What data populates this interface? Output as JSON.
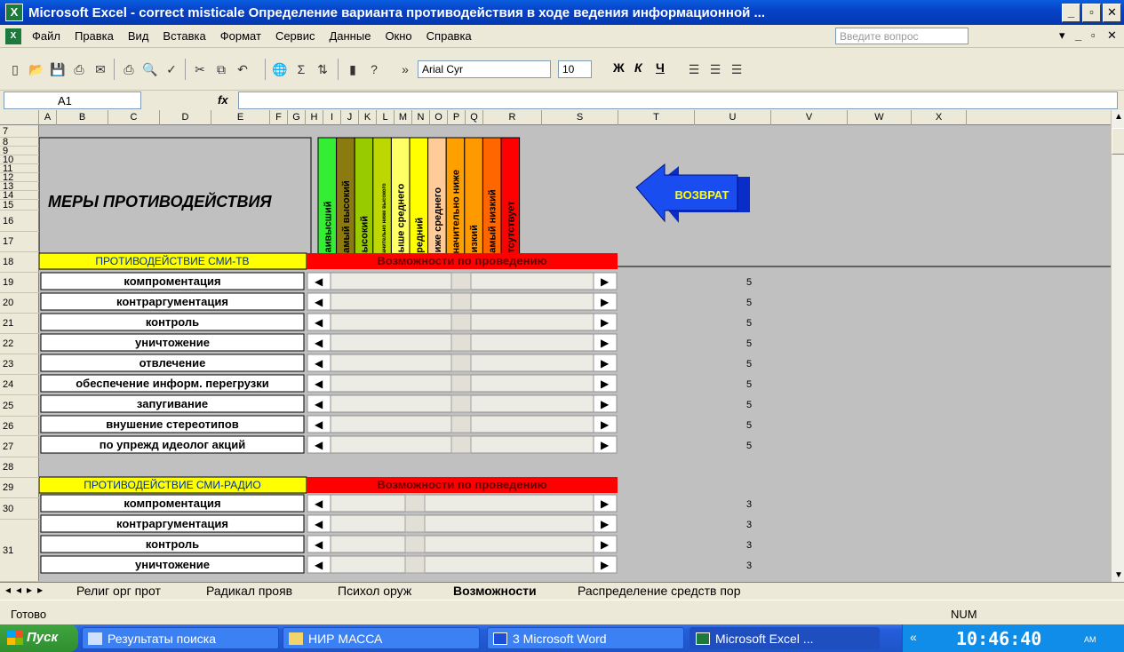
{
  "window": {
    "title": "Microsoft Excel - correct misticale Определение варианта противодействия в ходе ведения информационной ..."
  },
  "menu": {
    "items": [
      "Файл",
      "Правка",
      "Вид",
      "Вставка",
      "Формат",
      "Сервис",
      "Данные",
      "Окно",
      "Справка"
    ],
    "ask_placeholder": "Введите вопрос"
  },
  "toolbar": {
    "font": "Arial Cyr",
    "size": "10"
  },
  "formula": {
    "cell": "A1",
    "fx": "fx"
  },
  "columns": [
    "A",
    "B",
    "C",
    "D",
    "E",
    "F",
    "G",
    "H",
    "I",
    "J",
    "K",
    "L",
    "M",
    "N",
    "O",
    "P",
    "Q",
    "R",
    "S",
    "T",
    "U",
    "V",
    "W",
    "X"
  ],
  "rows": [
    "7",
    "8",
    "9",
    "10",
    "11",
    "12",
    "13",
    "14",
    "15",
    "16",
    "17",
    "18",
    "19",
    "20",
    "21",
    "22",
    "23",
    "24",
    "25",
    "26",
    "27",
    "28",
    "29",
    "30",
    "31"
  ],
  "header": {
    "measures": "МЕРЫ ПРОТИВОДЕЙСТВИЯ",
    "levels": [
      {
        "label": "наивысший",
        "color": "#33ee33"
      },
      {
        "label": "самый высокий",
        "color": "#8b7a10"
      },
      {
        "label": "высокий",
        "color": "#99cc00"
      },
      {
        "label": "значительно ниже высокого",
        "color": "#bdd800"
      },
      {
        "label": "выше среднего",
        "color": "#ffff66"
      },
      {
        "label": "средний",
        "color": "#ffff00"
      },
      {
        "label": "ниже среднего",
        "color": "#ffcc99"
      },
      {
        "label": "значительно ниже",
        "color": "#ffa000"
      },
      {
        "label": "низкий",
        "color": "#ff9900"
      },
      {
        "label": "самый низкий",
        "color": "#ff6600"
      },
      {
        "label": "отсутствует",
        "color": "#ff0000"
      }
    ],
    "return_button": "ВОЗВРАТ"
  },
  "section_tv": {
    "title": "ПРОТИВОДЕЙСТВИЕ СМИ-ТВ",
    "possibilities": "Возможности по проведению",
    "rows": [
      {
        "label": "компроментация",
        "value": "5"
      },
      {
        "label": "контраргументация",
        "value": "5"
      },
      {
        "label": "контроль",
        "value": "5"
      },
      {
        "label": "уничтожение",
        "value": "5"
      },
      {
        "label": "отвлечение",
        "value": "5"
      },
      {
        "label": "обеспечение информ. перегрузки",
        "value": "5"
      },
      {
        "label": "запугивание",
        "value": "5"
      },
      {
        "label": "внушение стереотипов",
        "value": "5"
      },
      {
        "label": "по упрежд идеолог акций",
        "value": "5"
      }
    ]
  },
  "section_radio": {
    "title": "ПРОТИВОДЕЙСТВИЕ СМИ-РАДИО",
    "possibilities": "Возможности по проведению",
    "rows": [
      {
        "label": "компроментация",
        "value": "3"
      },
      {
        "label": "контраргументация",
        "value": "3"
      },
      {
        "label": "контроль",
        "value": "3"
      },
      {
        "label": "уничтожение",
        "value": "3"
      }
    ]
  },
  "sheets": [
    "Религ орг прот",
    "Радикал прояв",
    "Психол оруж",
    "Возможности",
    "Распределение средств пор"
  ],
  "active_sheet": "Возможности",
  "status": {
    "ready": "Готово",
    "num": "NUM"
  },
  "taskbar": {
    "start": "Пуск",
    "tasks": [
      "Результаты поиска",
      "НИР МАССА",
      "3 Microsoft Word",
      "Microsoft Excel ..."
    ],
    "tray_prefix": "«",
    "clock": "10:46:40",
    "clock_suffix": "AM"
  }
}
